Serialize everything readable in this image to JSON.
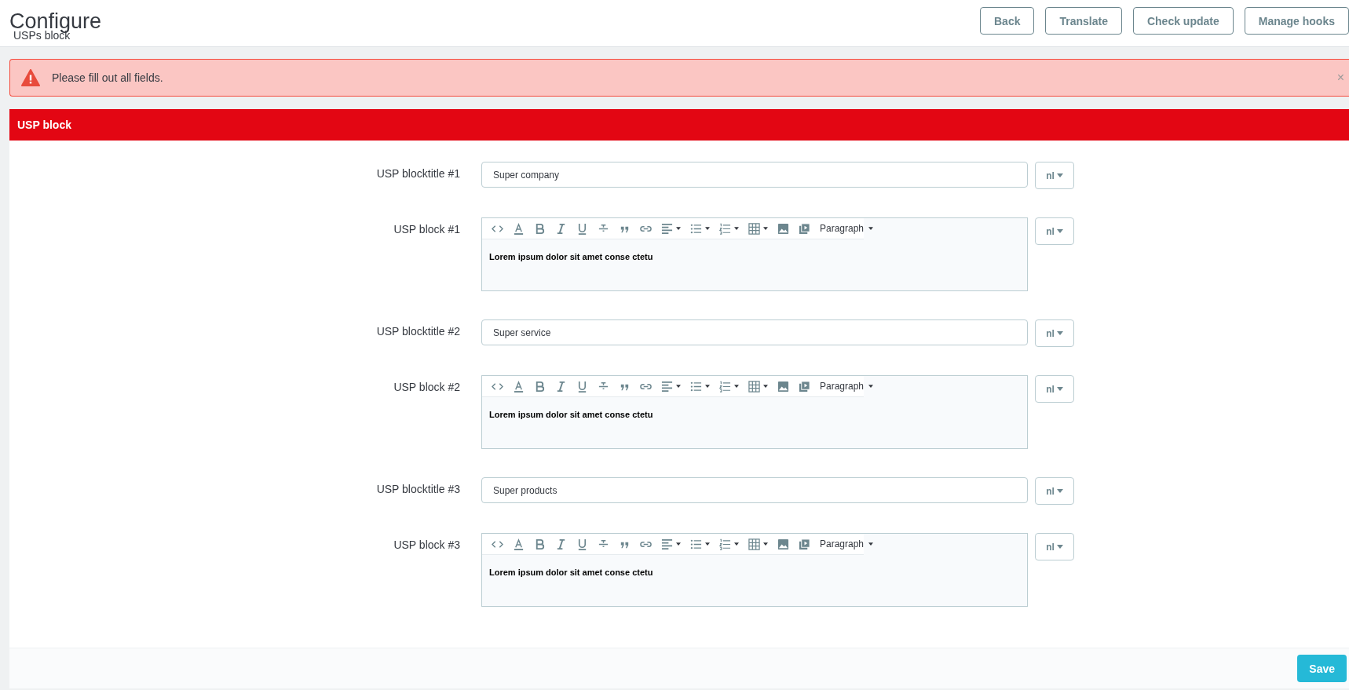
{
  "header": {
    "title": "Configure",
    "subtitle": "USPs block",
    "buttons": [
      "Back",
      "Translate",
      "Check update",
      "Manage hooks"
    ]
  },
  "alert": {
    "message": "Please fill out all fields.",
    "close": "×"
  },
  "panel": {
    "title": "USP block",
    "fields": [
      {
        "kind": "input",
        "label": "USP blocktitle #1",
        "value": "Super company",
        "lang": "nl"
      },
      {
        "kind": "editor",
        "label": "USP block #1",
        "format": "Paragraph",
        "content": "Lorem ipsum dolor sit amet conse ctetu",
        "lang": "nl"
      },
      {
        "kind": "input",
        "label": "USP blocktitle #2",
        "value": "Super service",
        "lang": "nl"
      },
      {
        "kind": "editor",
        "label": "USP block #2",
        "format": "Paragraph",
        "content": "Lorem ipsum dolor sit amet conse ctetu",
        "lang": "nl"
      },
      {
        "kind": "input",
        "label": "USP blocktitle #3",
        "value": "Super products",
        "lang": "nl"
      },
      {
        "kind": "editor",
        "label": "USP block #3",
        "format": "Paragraph",
        "content": "Lorem ipsum dolor sit amet conse ctetu",
        "lang": "nl"
      }
    ],
    "save": "Save"
  }
}
